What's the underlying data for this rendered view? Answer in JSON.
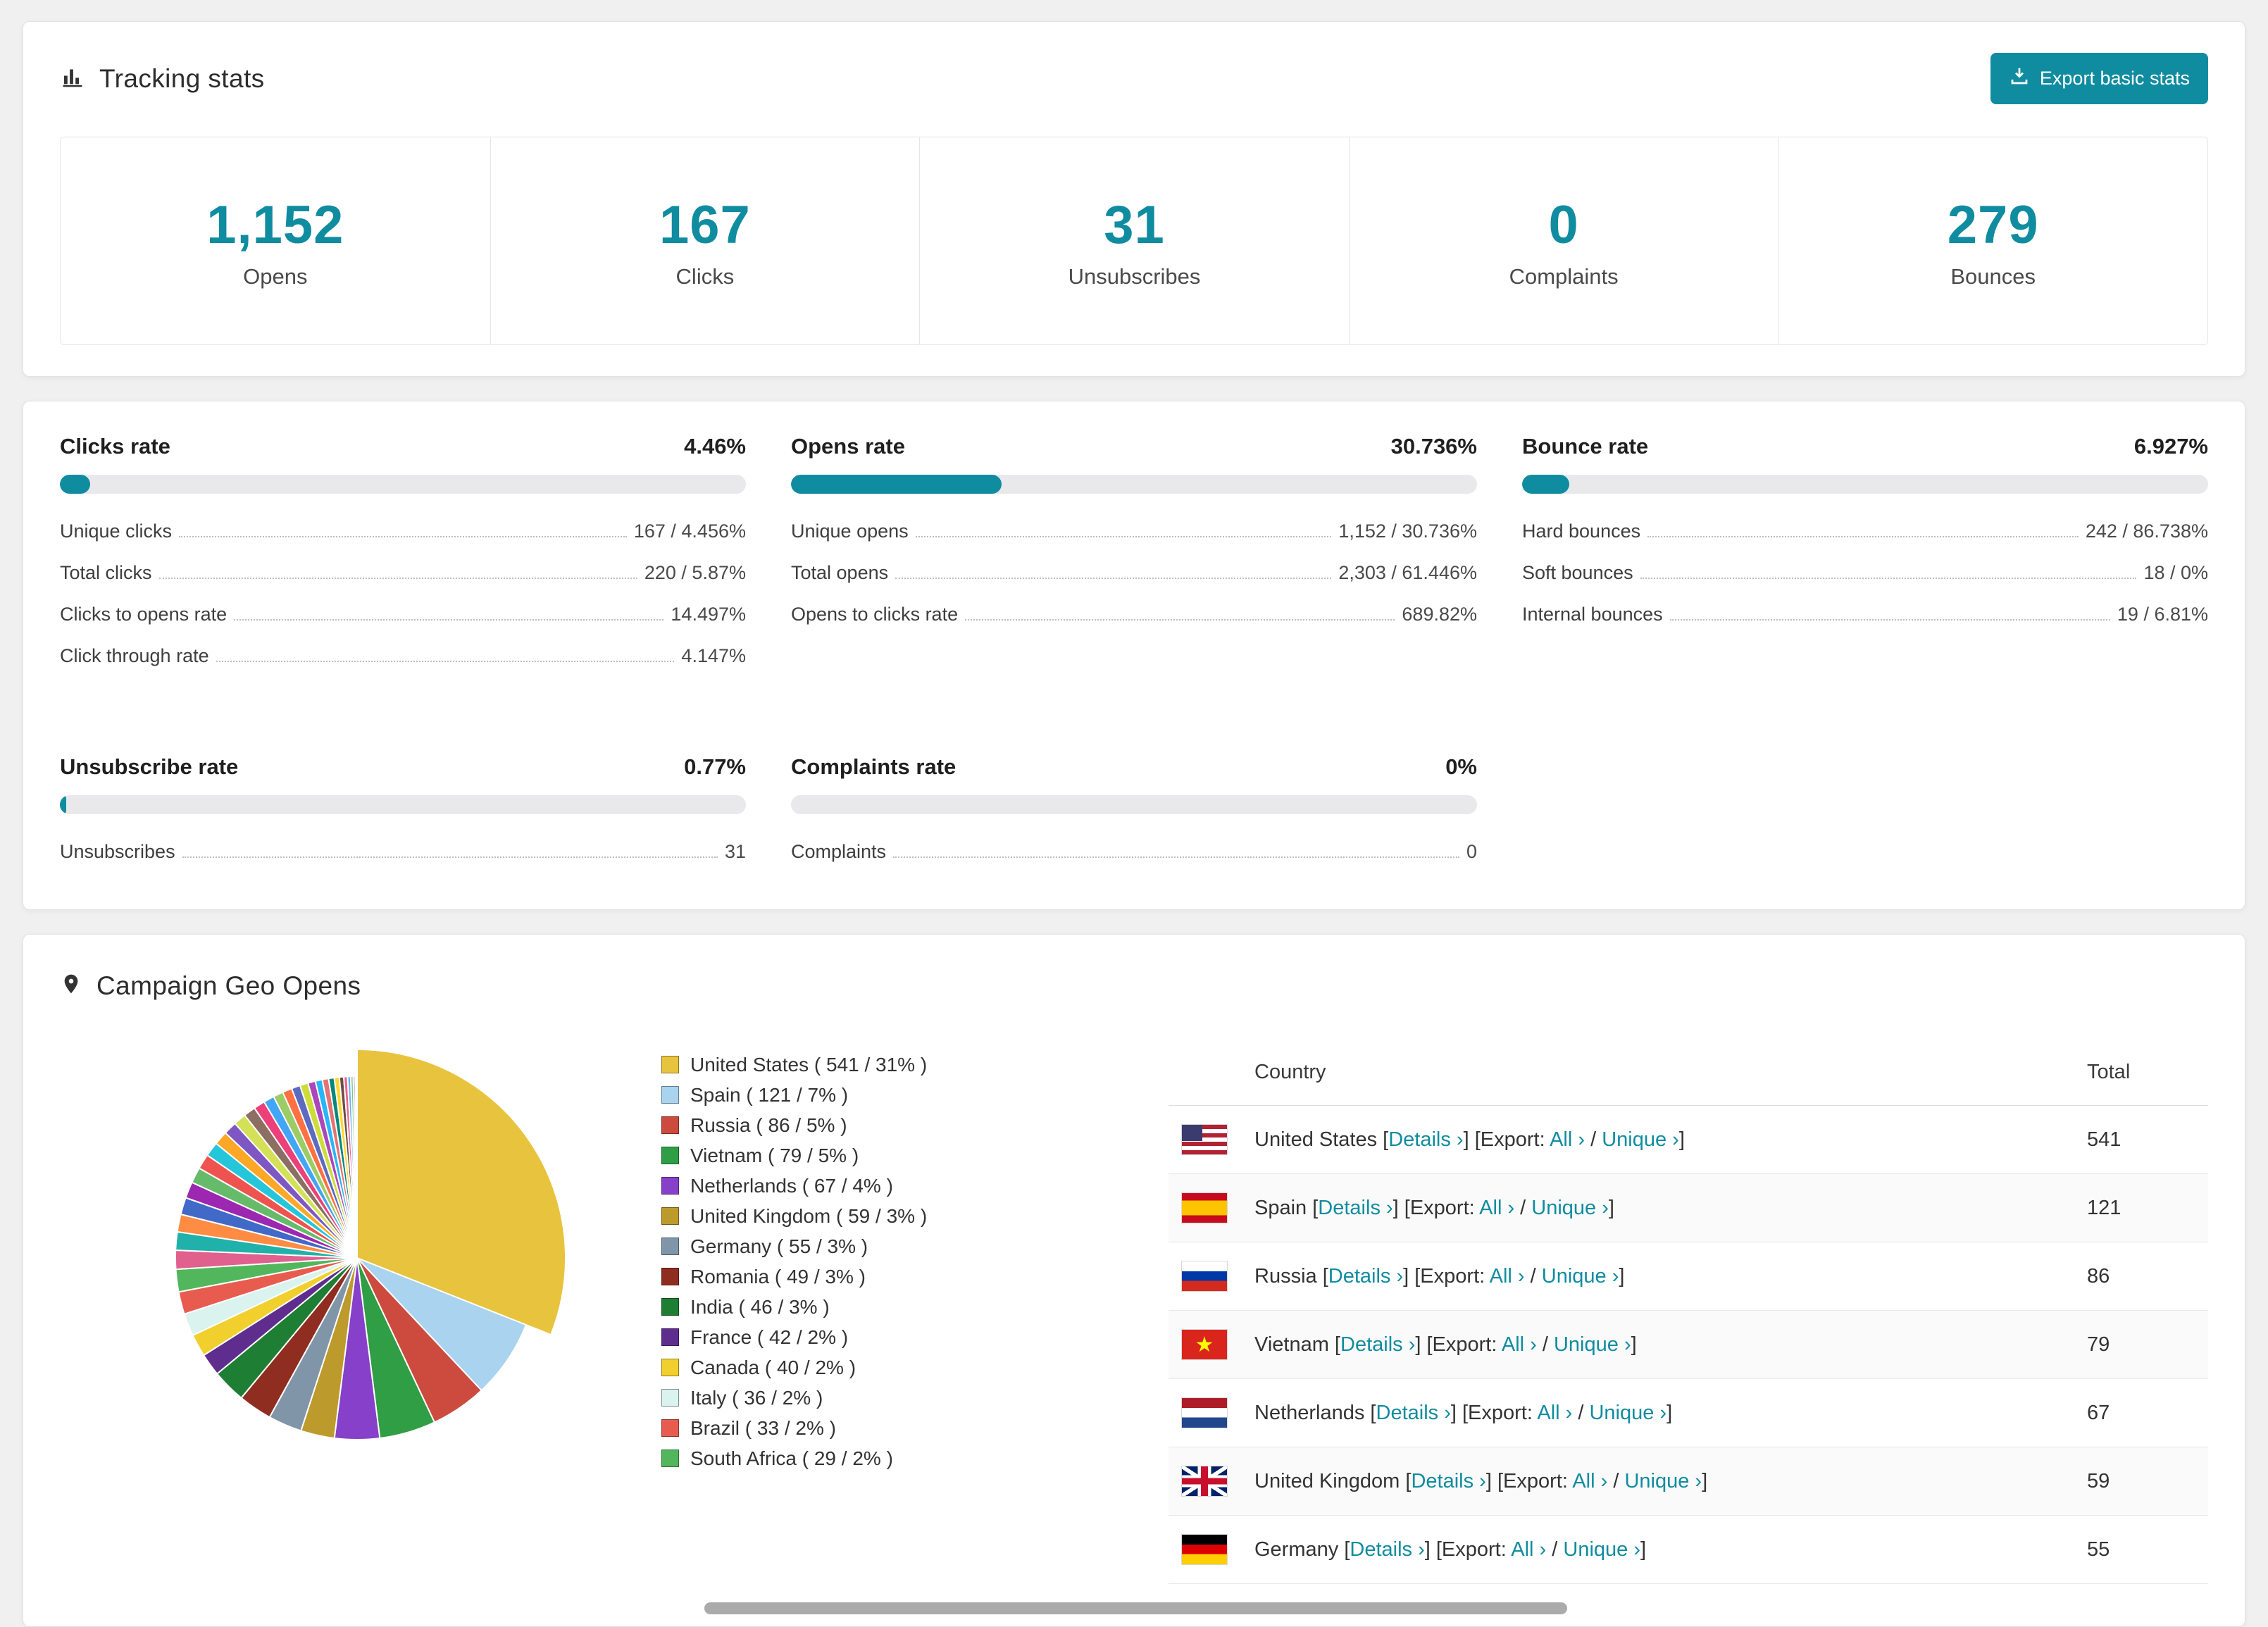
{
  "colors": {
    "accent": "#108ca0",
    "bar_track": "#e9e9ec"
  },
  "tracking": {
    "title": "Tracking stats",
    "export_button": "Export basic stats",
    "stats": [
      {
        "value": "1,152",
        "label": "Opens"
      },
      {
        "value": "167",
        "label": "Clicks"
      },
      {
        "value": "31",
        "label": "Unsubscribes"
      },
      {
        "value": "0",
        "label": "Complaints"
      },
      {
        "value": "279",
        "label": "Bounces"
      }
    ]
  },
  "rates": [
    {
      "title": "Clicks rate",
      "value": "4.46%",
      "bar_percent": 4.46,
      "rows": [
        {
          "label": "Unique clicks",
          "value": "167 / 4.456%"
        },
        {
          "label": "Total clicks",
          "value": "220 / 5.87%"
        },
        {
          "label": "Clicks to opens rate",
          "value": "14.497%"
        },
        {
          "label": "Click through rate",
          "value": "4.147%"
        }
      ]
    },
    {
      "title": "Opens rate",
      "value": "30.736%",
      "bar_percent": 30.736,
      "rows": [
        {
          "label": "Unique opens",
          "value": "1,152 / 30.736%"
        },
        {
          "label": "Total opens",
          "value": "2,303 / 61.446%"
        },
        {
          "label": "Opens to clicks rate",
          "value": "689.82%"
        }
      ]
    },
    {
      "title": "Bounce rate",
      "value": "6.927%",
      "bar_percent": 6.927,
      "rows": [
        {
          "label": "Hard bounces",
          "value": "242 / 86.738%"
        },
        {
          "label": "Soft bounces",
          "value": "18 / 0%"
        },
        {
          "label": "Internal bounces",
          "value": "19 / 6.81%"
        }
      ]
    },
    {
      "title": "Unsubscribe rate",
      "value": "0.77%",
      "bar_percent": 0.77,
      "rows": [
        {
          "label": "Unsubscribes",
          "value": "31"
        }
      ]
    },
    {
      "title": "Complaints rate",
      "value": "0%",
      "bar_percent": 0,
      "rows": [
        {
          "label": "Complaints",
          "value": "0"
        }
      ]
    }
  ],
  "geo": {
    "title": "Campaign Geo Opens",
    "table": {
      "col_country": "Country",
      "col_total": "Total",
      "details_label": "Details ›",
      "export_label": "Export:",
      "all_label": "All ›",
      "unique_label": "Unique ›",
      "rows": [
        {
          "country": "United States",
          "flag": "us",
          "total": "541"
        },
        {
          "country": "Spain",
          "flag": "es",
          "total": "121"
        },
        {
          "country": "Russia",
          "flag": "ru",
          "total": "86"
        },
        {
          "country": "Vietnam",
          "flag": "vn",
          "total": "79"
        },
        {
          "country": "Netherlands",
          "flag": "nl",
          "total": "67"
        },
        {
          "country": "United Kingdom",
          "flag": "gb",
          "total": "59"
        },
        {
          "country": "Germany",
          "flag": "de",
          "total": "55"
        }
      ]
    }
  },
  "chart_data": {
    "type": "pie",
    "title": "Campaign Geo Opens",
    "legend_position": "right",
    "slices": [
      {
        "label": "United States",
        "value": 541,
        "pct": 31,
        "color": "#e8c33d"
      },
      {
        "label": "Spain",
        "value": 121,
        "pct": 7,
        "color": "#a9d3ee"
      },
      {
        "label": "Russia",
        "value": 86,
        "pct": 5,
        "color": "#cc4b3e"
      },
      {
        "label": "Vietnam",
        "value": 79,
        "pct": 5,
        "color": "#2f9e44"
      },
      {
        "label": "Netherlands",
        "value": 67,
        "pct": 4,
        "color": "#8740c9"
      },
      {
        "label": "United Kingdom",
        "value": 59,
        "pct": 3,
        "color": "#bd9a2c"
      },
      {
        "label": "Germany",
        "value": 55,
        "pct": 3,
        "color": "#8096a8"
      },
      {
        "label": "Romania",
        "value": 49,
        "pct": 3,
        "color": "#8f2d20"
      },
      {
        "label": "India",
        "value": 46,
        "pct": 3,
        "color": "#1e7e34"
      },
      {
        "label": "France",
        "value": 42,
        "pct": 2,
        "color": "#5f2d8e"
      },
      {
        "label": "Canada",
        "value": 40,
        "pct": 2,
        "color": "#f1d02e"
      },
      {
        "label": "Italy",
        "value": 36,
        "pct": 2,
        "color": "#dbf3ef"
      },
      {
        "label": "Brazil",
        "value": 33,
        "pct": 2,
        "color": "#e85c50"
      },
      {
        "label": "South Africa",
        "value": 29,
        "pct": 2,
        "color": "#52b75c"
      }
    ],
    "others": {
      "approx_total_pct": 26,
      "colors": [
        "#e0608e",
        "#20b2aa",
        "#ff8c42",
        "#4169c8",
        "#9c27b0",
        "#66bb6a",
        "#ef5350",
        "#26c6da",
        "#ffa726",
        "#7e57c2",
        "#d4e157",
        "#8d6e63",
        "#ec407a",
        "#42a5f5",
        "#9ccc65",
        "#ff7043",
        "#5c6bc0",
        "#cddc39",
        "#ab47bc",
        "#29b6f6",
        "#e57373",
        "#00897b",
        "#fdd835",
        "#6d4c41",
        "#f06292",
        "#64b5f6",
        "#81c784",
        "#ba68c8",
        "#ffb300",
        "#4db6ac"
      ]
    }
  }
}
